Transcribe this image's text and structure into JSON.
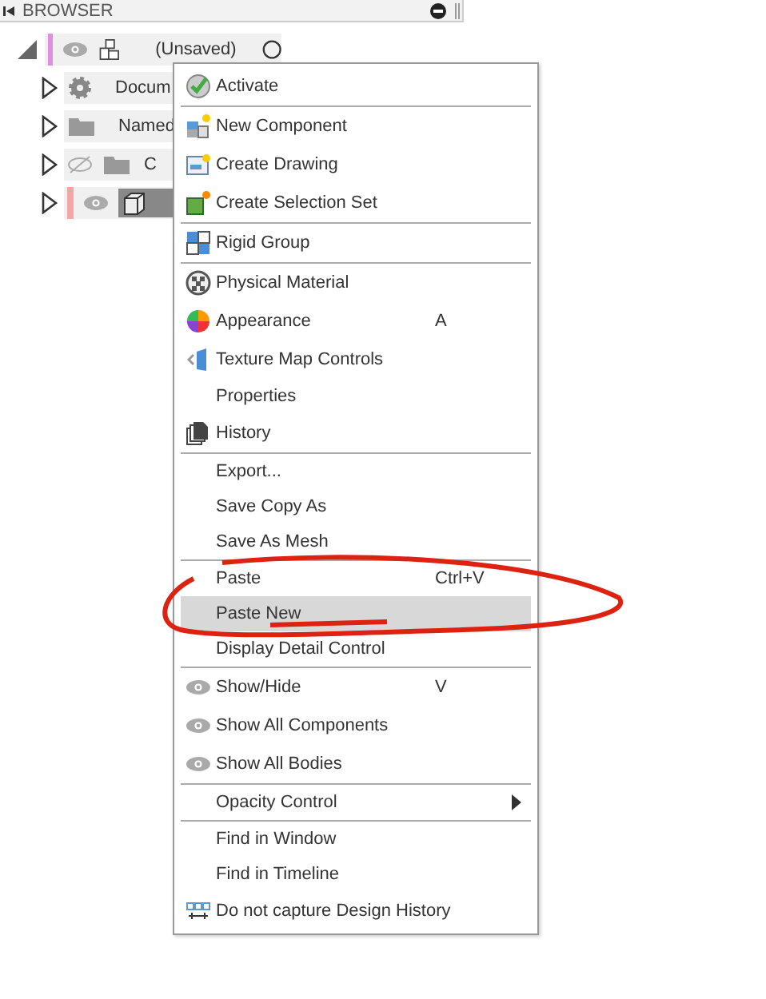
{
  "panel": {
    "title": "BROWSER"
  },
  "tree": [
    {
      "kind": "root",
      "label": "(Unsaved)",
      "expanded": true,
      "visible": true,
      "selected": false
    },
    {
      "kind": "settings",
      "label": "Docum",
      "expanded": false,
      "selected": false
    },
    {
      "kind": "folder",
      "label": "Named",
      "expanded": false,
      "selected": false
    },
    {
      "kind": "folder",
      "label": "C",
      "expanded": false,
      "visible": false,
      "selected": false
    },
    {
      "kind": "body",
      "expanded": false,
      "visible": true,
      "selected": true
    }
  ],
  "menu": [
    {
      "label": "Activate",
      "kind": "check",
      "separator_after": true,
      "selected": false
    },
    {
      "label": "New Component",
      "kind": "component",
      "selected": false
    },
    {
      "label": "Create Drawing",
      "kind": "drawing",
      "selected": false
    },
    {
      "label": "Create Selection Set",
      "kind": "selection",
      "separator_after": true,
      "selected": false
    },
    {
      "label": "Rigid Group",
      "kind": "rigid",
      "separator_after": true,
      "selected": false
    },
    {
      "label": "Physical Material",
      "kind": "material",
      "selected": false
    },
    {
      "label": "Appearance",
      "kind": "appearance",
      "shortcut": "A",
      "selected": false
    },
    {
      "label": "Texture Map Controls",
      "kind": "texture",
      "selected": false
    },
    {
      "label": "Properties",
      "selected": false
    },
    {
      "label": "History",
      "kind": "history",
      "separator_after": true,
      "selected": false
    },
    {
      "label": "Export...",
      "selected": false
    },
    {
      "label": "Save Copy As",
      "selected": false
    },
    {
      "label": "Save As Mesh",
      "separator_after": true,
      "selected": false
    },
    {
      "label": "Paste",
      "shortcut": "Ctrl+V",
      "selected": false
    },
    {
      "label": "Paste New",
      "selected": true
    },
    {
      "label": "Display Detail Control",
      "separator_after": true,
      "selected": false
    },
    {
      "label": "Show/Hide",
      "kind": "eye",
      "shortcut": "V",
      "selected": false
    },
    {
      "label": "Show All Components",
      "kind": "eye",
      "selected": false
    },
    {
      "label": "Show All Bodies",
      "kind": "eye",
      "separator_after": true,
      "selected": false
    },
    {
      "label": "Opacity Control",
      "submenu": true,
      "separator_after": true,
      "selected": false
    },
    {
      "label": "Find in Window",
      "selected": false
    },
    {
      "label": "Find in Timeline",
      "selected": false
    },
    {
      "label": "Do not capture Design History",
      "kind": "capture",
      "selected": false
    }
  ]
}
